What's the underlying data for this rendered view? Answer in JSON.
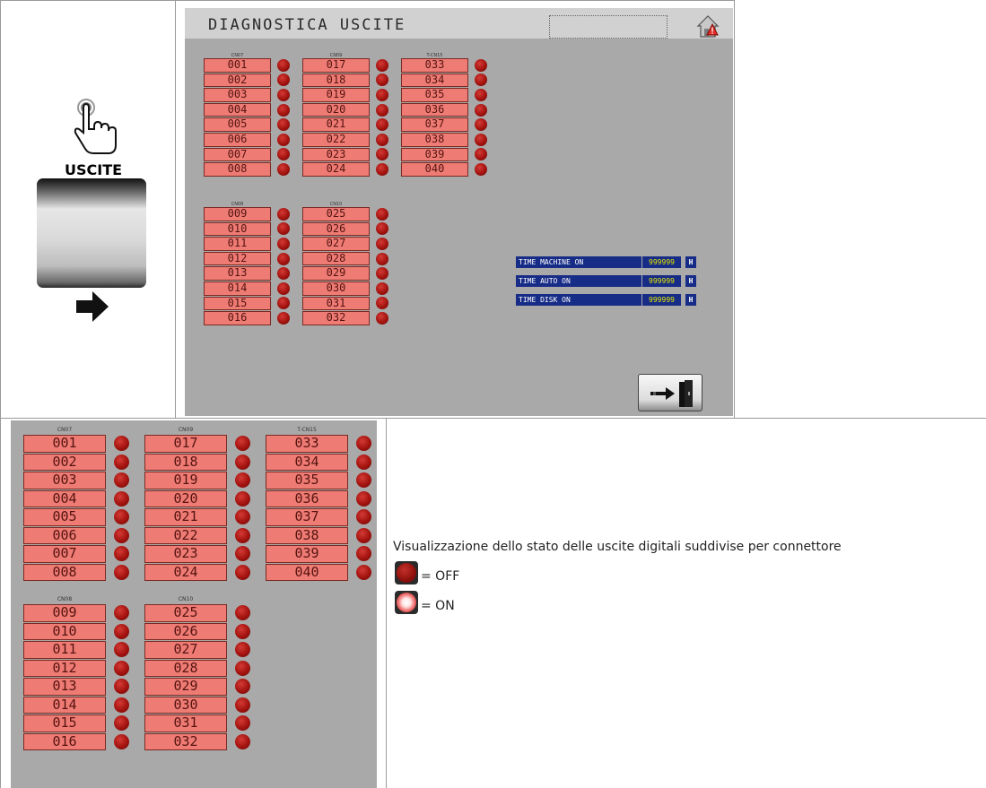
{
  "nav": {
    "label": "USCITE",
    "icons": {
      "hand": "touch-hand-icon",
      "arrow": "right-arrow-icon"
    }
  },
  "hmi": {
    "title": "DIAGNOSTICA USCITE",
    "home_icon": "home-alarm-icon",
    "exit_icon": "exit-door-icon",
    "groups": [
      {
        "header": "CN07",
        "outputs": [
          "001",
          "002",
          "003",
          "004",
          "005",
          "006",
          "007",
          "008"
        ]
      },
      {
        "header": "CN09",
        "outputs": [
          "017",
          "018",
          "019",
          "020",
          "021",
          "022",
          "023",
          "024"
        ]
      },
      {
        "header": "T-CN15",
        "outputs": [
          "033",
          "034",
          "035",
          "036",
          "037",
          "038",
          "039",
          "040"
        ]
      },
      {
        "header": "CN08",
        "outputs": [
          "009",
          "010",
          "011",
          "012",
          "013",
          "014",
          "015",
          "016"
        ]
      },
      {
        "header": "CN10",
        "outputs": [
          "025",
          "026",
          "027",
          "028",
          "029",
          "030",
          "031",
          "032"
        ]
      }
    ],
    "led_state": "off",
    "times": [
      {
        "label": "TIME MACHINE ON",
        "value": "999999",
        "unit": "H"
      },
      {
        "label": "TIME AUTO ON",
        "value": "999999",
        "unit": "H"
      },
      {
        "label": "TIME DISK ON",
        "value": "999999",
        "unit": "H"
      }
    ]
  },
  "description": "Visualizzazione dello stato delle uscite digitali suddivise per connettore",
  "legend": [
    {
      "state": "off",
      "text": "= OFF"
    },
    {
      "state": "on",
      "text": "= ON"
    }
  ],
  "colors": {
    "output_box": "#ef7b75",
    "led_off": "#a3130f",
    "time_bar": "#172c86",
    "time_value": "#e6e600",
    "panel_bg": "#a9a9a9"
  }
}
